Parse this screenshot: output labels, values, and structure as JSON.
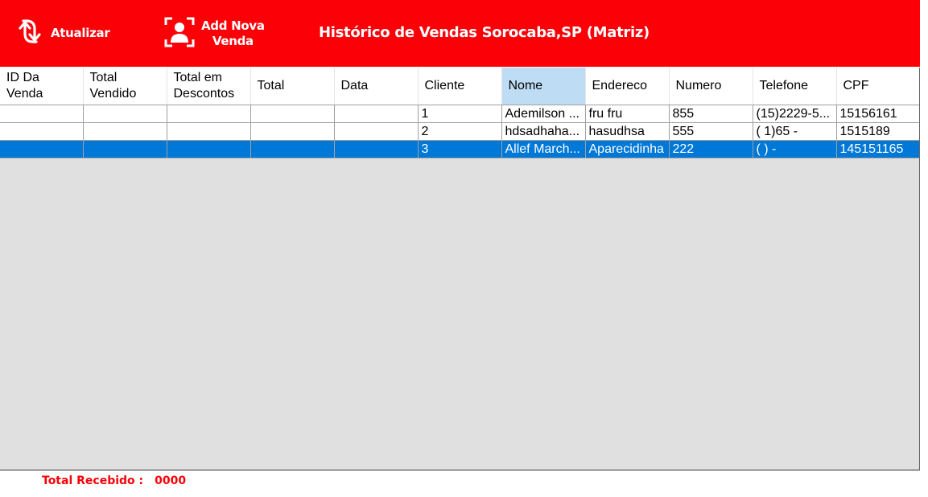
{
  "toolbar": {
    "refresh_label": "Atualizar",
    "add_label_line1": "Add Nova",
    "add_label_line2": "Venda"
  },
  "title": "Histórico de Vendas Sorocaba,SP (Matriz)",
  "table": {
    "headers": [
      [
        "ID Da",
        "Venda"
      ],
      [
        "Total",
        "Vendido"
      ],
      [
        "Total em",
        "Descontos"
      ],
      [
        "Total",
        ""
      ],
      [
        "Data",
        ""
      ],
      [
        "Cliente",
        ""
      ],
      [
        "Nome",
        ""
      ],
      [
        "Endereco",
        ""
      ],
      [
        "Numero",
        ""
      ],
      [
        "Telefone",
        ""
      ],
      [
        "CPF",
        ""
      ]
    ],
    "sorted_column": "Nome",
    "rows": [
      [
        "",
        "",
        "",
        "",
        "",
        "1",
        "Ademilson ...",
        "fru fru",
        "855",
        "(15)2229-5...",
        "15156161"
      ],
      [
        "",
        "",
        "",
        "",
        "",
        "2",
        "hdsadhaha...",
        "hasudhsa",
        "555",
        "( 1)65  -",
        "1515189"
      ],
      [
        "",
        "",
        "",
        "",
        "",
        "3",
        "Allef March...",
        "Aparecidinha",
        "222",
        "(  )    -",
        "145151165"
      ]
    ],
    "selected_row": 3
  },
  "footer": {
    "total_label": "Total Recebido :",
    "total_value": "0000"
  },
  "colors": {
    "brand": "#fb0006",
    "selection": "#0078d7",
    "sorted_header": "#bfdcf5",
    "grid_background": "#e0e0e0"
  },
  "icons": {
    "refresh": "refresh-arrows-icon",
    "add": "add-user-icon"
  }
}
